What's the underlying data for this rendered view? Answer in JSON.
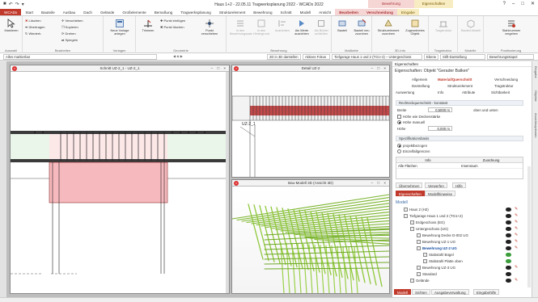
{
  "window_title": "Haus 1+2 - 22.05.11 Tragwerksplanung 2022 - WCADx 2022",
  "quick_access": [
    "■",
    "↶",
    "↷",
    "▾"
  ],
  "context_tabs": {
    "red": "Bewehrung",
    "yellow": "Eigenschaften"
  },
  "tabs": [
    "WCADx",
    "Start",
    "Bauteile",
    "Ausbau",
    "Dach",
    "Gelände",
    "Großelemente",
    "Bemaßung",
    "Tragwerksplanung",
    "Strukturelement",
    "Bewehrung",
    "Schnitt",
    "Modell",
    "Ansicht",
    "Bearbeiten",
    "Verschneidung",
    "Eingabe"
  ],
  "ribbon": {
    "auswahl": {
      "label": "Auswahl",
      "big": "Markieren"
    },
    "bearbeiten": {
      "label": "Bearbeiten",
      "items": [
        "Löschen",
        "Verschieben",
        "Übertragen",
        "Kopieren",
        "Wiederh.",
        "Drehen",
        "Spiegeln"
      ]
    },
    "vorlagen": {
      "label": "Vorlagen",
      "big": "Neue Vorlage anlegen"
    },
    "geometrie": {
      "label": "Geometrie",
      "big1": "Trimmen",
      "big2": "Punkt verschieben",
      "items": [
        "Punkt einfügen",
        "Punkt löschen"
      ]
    },
    "bewehrung": {
      "label": "Bewehrung",
      "items": [
        "In den Bewehrungssatz",
        "In den Hintergrund",
        "Ausrichten",
        "Als Werte ausrichten",
        "Als Bürkel schließen"
      ]
    },
    "bauteil": {
      "label": "Maßkette",
      "items": [
        "Bauteil",
        "Bauteil neu zuordnen"
      ]
    },
    "strukturelement": {
      "label": "3D-Info",
      "items": [
        "Strukturelement zuordnen",
        "Zugeordnetes Objekt"
      ]
    },
    "tragstruktur": {
      "label": "Tragstruktur",
      "items": [
        "Tragstruktur"
      ]
    },
    "modelle": {
      "label": "Modelle",
      "items": [
        "Bauteil-Modell"
      ]
    },
    "positionierung": {
      "label": "Positionierung",
      "items": [
        "Stahlnummer vergeben"
      ]
    }
  },
  "addressbar": {
    "layer": "Alles markierbar",
    "mid": "◀ ◈ ▶",
    "btn_3d": "2D in 3D darstellen",
    "btn_fokus": "Aktives Fokus",
    "right_combo": "Tiefgarage Haus 1 und 2 (TG1+2) – Untergeschoss",
    "ebene": "Ebene",
    "stift": "Stift-Darstellung",
    "bewehrung": "Bewehrungsstapel"
  },
  "views": {
    "v1": {
      "title": "Schnitt UZ-2_1 - UZ-2_1"
    },
    "v2": {
      "title": "Detail UZ-2",
      "label": "UZ-2_1"
    },
    "v3": {
      "title": "Bau-Modell 3D (Ansicht 3D)"
    }
  },
  "panel": {
    "header": "Eigenschaften",
    "title": "Eigenschaften: Objekt \"Gerader Balken\"",
    "tabs_row1": [
      "Allgemein",
      "Material/Querschnitt",
      "Verschneidung"
    ],
    "tabs_row2": [
      "Darstellung",
      "Strukturelement",
      "Tragstruktur"
    ],
    "tabs_row3": [
      "Auswertung",
      "Info",
      "Attribute",
      "Sichtbarkeit"
    ],
    "section1": "Rechteckquerschnitt - konstant",
    "fields": {
      "breite_label": "Breite",
      "breite_val": "0,5000 m",
      "breite_hint": "oben und unten",
      "hoehe_opt1": "Höhe wie Deckenstärke",
      "hoehe_opt2": "Höhe manuell",
      "hoehe_label": "Höhe",
      "hoehe_val": "0,000 m"
    },
    "section2": "Spezifikationsbasis",
    "radio1": "projektbezogen",
    "radio2": "Einzelfallgrenzen",
    "grid_head": [
      "Info",
      "Zuordnung"
    ],
    "grid_row": [
      "Alle Flächen",
      "Innenraum"
    ],
    "bottom_tabs": [
      "Übernehmen",
      "Verwerfen",
      "Hilfe"
    ],
    "tabs2": [
      "Eigenschaften",
      "Modellhinweise"
    ],
    "tree_title": "Modell",
    "tree": [
      {
        "label": "Haus 2 (H2)",
        "level": 1
      },
      {
        "label": "Tiefgarage Haus 1 und 2 (TG1+2)",
        "level": 1
      },
      {
        "label": "Erdgeschoss (EG)",
        "level": 2
      },
      {
        "label": "Untergeschoss (UG)",
        "level": 2
      },
      {
        "label": "Bewehrung Decke D-002 UG",
        "level": 3
      },
      {
        "label": "Bewehrung UZ-1 UG",
        "level": 3
      },
      {
        "label": "Bewehrung UZ-2 UG",
        "level": 3
      },
      {
        "label": "Stabstahl Bügel",
        "level": 4
      },
      {
        "label": "Stabstahl Platte oben",
        "level": 4
      },
      {
        "label": "Bewehrung UZ-3 UG",
        "level": 3
      },
      {
        "label": "Standard",
        "level": 3
      },
      {
        "label": "Gelände",
        "level": 2
      }
    ],
    "footer_tabs": [
      "Modell",
      "Sichten",
      "Ausgabeverwaltung",
      "Eingabehilfe"
    ],
    "side_tabs": [
      "Eingabe",
      "Objekte",
      "Ansichtsoptionen"
    ]
  },
  "colors": {
    "accent": "#c0392b",
    "rebar": "#8fc83a",
    "beam_fill": "#f4b5b8",
    "panel_bg": "#ffffff"
  }
}
